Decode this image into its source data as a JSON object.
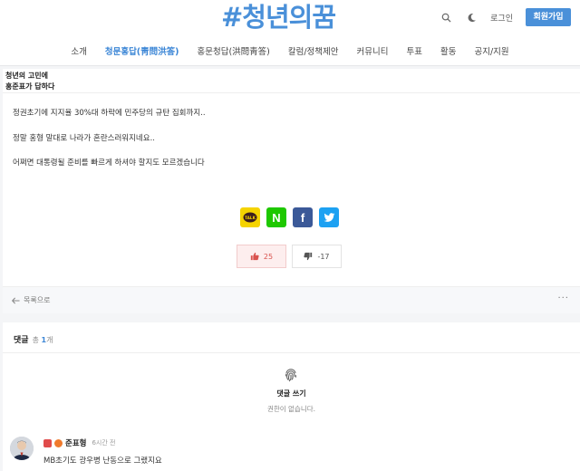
{
  "header": {
    "logo": "#청년의꿈",
    "login_label": "로그인",
    "signup_label": "회원가입",
    "icons": [
      "search-icon",
      "moon-icon"
    ]
  },
  "nav": {
    "items": [
      "소개",
      "청문홍답(靑問洪答)",
      "홍문청답(洪問靑答)",
      "칼럼/정책제안",
      "커뮤니티",
      "투표",
      "활동",
      "공지/지원"
    ],
    "active_index": 1
  },
  "post": {
    "title_line1": "청년의 고민에",
    "title_line2": "홍준표가 답하다",
    "paragraphs": [
      "정권초기에 지지율 30%대 하락에 민주당의 규탄 집회까지..",
      "정말 홍형 말대로 나라가 혼란스러워지네요..",
      "어쩌면 대통령될 준비를 빠르게 하셔야 할지도 모르겠습니다"
    ],
    "share_icons": [
      "kakaotalk-icon",
      "naver-icon",
      "facebook-icon",
      "twitter-icon"
    ],
    "kakao_label": "TALK",
    "naver_label": "N",
    "facebook_label": "f",
    "upvotes": "25",
    "downvotes": "-17",
    "back_label": "목록으로",
    "more_label": "···"
  },
  "comments": {
    "heading": "댓글",
    "total_label": "총",
    "count": "1",
    "count_suffix": "개",
    "write_label": "댓글 쓰기",
    "no_permission": "권한이 없습니다.",
    "items": [
      {
        "author": "준표형",
        "time": "6시간 전",
        "text": "MB초기도 광우병 난동으로 그랬지요"
      }
    ]
  },
  "colors": {
    "accent": "#4a90d9",
    "upvote": "#d9534f",
    "kakao": "#f5d300",
    "naver": "#1ec800",
    "facebook": "#3b5998",
    "twitter": "#1da1f2"
  }
}
